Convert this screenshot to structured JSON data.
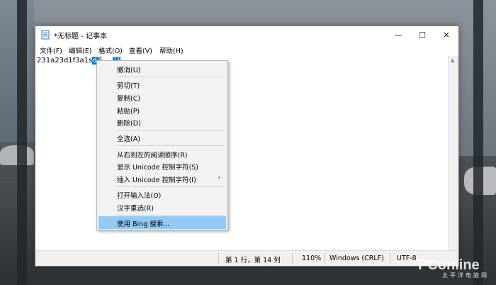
{
  "window": {
    "title": "*无标题 - 记事本",
    "minimize_glyph": "—",
    "maximize_glyph": "☐",
    "close_glyph": "✕"
  },
  "menubar": {
    "items": [
      "文件(F)",
      "编辑(E)",
      "格式(O)",
      "查看(V)",
      "帮助(H)"
    ]
  },
  "editor": {
    "text_before": "231a23d1f3a1s",
    "text_selected": "d3",
    "text_selected_tail": "23"
  },
  "context_menu": {
    "items": [
      {
        "label": "撤消(U)"
      },
      {
        "label": "剪切(T)"
      },
      {
        "label": "复制(C)"
      },
      {
        "label": "粘贴(P)"
      },
      {
        "label": "删除(D)"
      },
      {
        "label": "全选(A)"
      },
      {
        "label": "从右到左的阅读顺序(R)"
      },
      {
        "label": "显示 Unicode 控制字符(S)"
      },
      {
        "label": "插入 Unicode 控制字符(I)",
        "submenu_glyph": "›"
      },
      {
        "label": "打开输入法(O)"
      },
      {
        "label": "汉字重选(R)"
      },
      {
        "label": "使用 Bing 搜索..."
      }
    ],
    "highlighted_item": "使用 Bing 搜索..."
  },
  "statusbar": {
    "position": "第 1 行，第 14 列",
    "zoom": "110%",
    "line_ending": "Windows (CRLF)",
    "encoding": "UTF-8"
  },
  "watermark": {
    "main": "PConline",
    "sub": "太平洋电脑网"
  },
  "colors": {
    "selection": "#0078d7",
    "menu_highlight": "#91c9f7"
  }
}
